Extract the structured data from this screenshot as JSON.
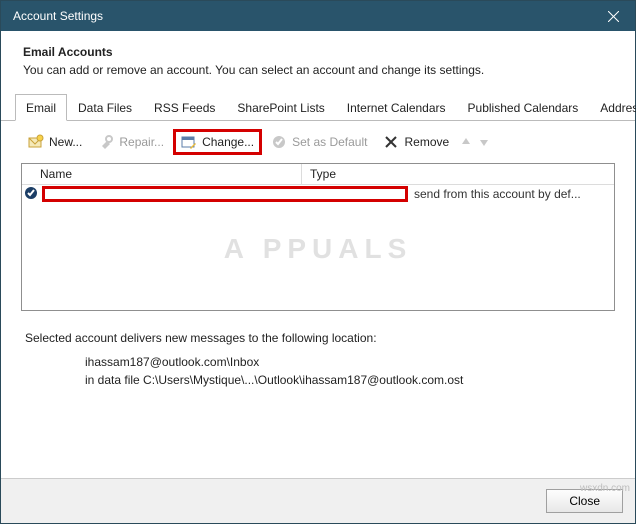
{
  "titlebar": {
    "title": "Account Settings"
  },
  "header": {
    "heading": "Email Accounts",
    "desc": "You can add or remove an account. You can select an account and change its settings."
  },
  "tabs": {
    "items": [
      {
        "label": "Email"
      },
      {
        "label": "Data Files"
      },
      {
        "label": "RSS Feeds"
      },
      {
        "label": "SharePoint Lists"
      },
      {
        "label": "Internet Calendars"
      },
      {
        "label": "Published Calendars"
      },
      {
        "label": "Address Books"
      }
    ]
  },
  "toolbar": {
    "new_label": "New...",
    "repair_label": "Repair...",
    "change_label": "Change...",
    "default_label": "Set as Default",
    "remove_label": "Remove"
  },
  "columns": {
    "name": "Name",
    "type": "Type"
  },
  "list": {
    "rows": [
      {
        "name": "",
        "type": "send from this account by def..."
      }
    ]
  },
  "summary": {
    "line": "Selected account delivers new messages to the following location:",
    "loc_title": "ihassam187@outlook.com\\Inbox",
    "loc_path": "in data file C:\\Users\\Mystique\\...\\Outlook\\ihassam187@outlook.com.ost"
  },
  "footer": {
    "close_label": "Close"
  },
  "watermark": "A  PPUALS",
  "credit": "wsxdn.com"
}
